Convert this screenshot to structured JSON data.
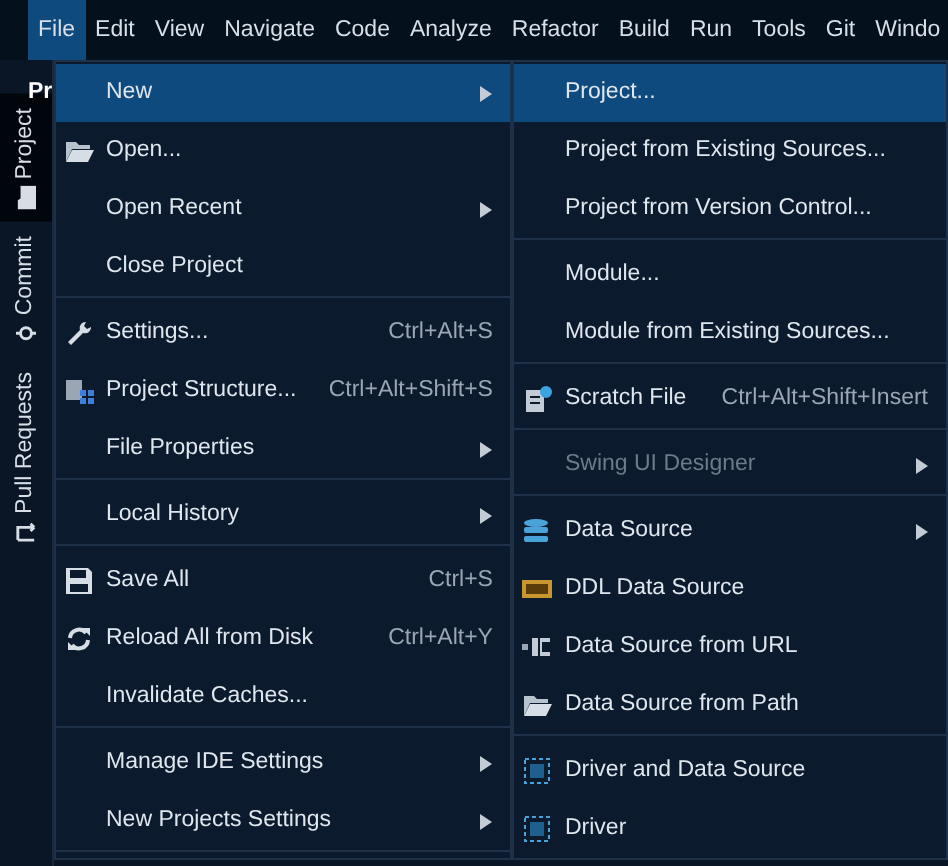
{
  "menubar": {
    "items": [
      {
        "label": "File",
        "selected": true
      },
      {
        "label": "Edit",
        "selected": false
      },
      {
        "label": "View",
        "selected": false
      },
      {
        "label": "Navigate",
        "selected": false
      },
      {
        "label": "Code",
        "selected": false
      },
      {
        "label": "Analyze",
        "selected": false
      },
      {
        "label": "Refactor",
        "selected": false
      },
      {
        "label": "Build",
        "selected": false
      },
      {
        "label": "Run",
        "selected": false
      },
      {
        "label": "Tools",
        "selected": false
      },
      {
        "label": "Git",
        "selected": false
      },
      {
        "label": "Windo",
        "selected": false
      }
    ]
  },
  "sidebar": {
    "panel_title": "Pr",
    "tabs": [
      {
        "label": "Project",
        "selected": true
      },
      {
        "label": "Commit",
        "selected": false
      },
      {
        "label": "Pull Requests",
        "selected": false
      }
    ]
  },
  "file_menu": [
    {
      "kind": "item",
      "label": "New",
      "submenu": true,
      "selected": true
    },
    {
      "kind": "item",
      "label": "Open...",
      "submenu": false,
      "selected": false
    },
    {
      "kind": "item",
      "label": "Open Recent",
      "submenu": true,
      "selected": false
    },
    {
      "kind": "item",
      "label": "Close Project",
      "submenu": false,
      "selected": false
    },
    {
      "kind": "separator"
    },
    {
      "kind": "item",
      "label": "Settings...",
      "shortcut": "Ctrl+Alt+S",
      "submenu": false,
      "selected": false
    },
    {
      "kind": "item",
      "label": "Project Structure...",
      "shortcut": "Ctrl+Alt+Shift+S",
      "submenu": false,
      "selected": false
    },
    {
      "kind": "item",
      "label": "File Properties",
      "submenu": true,
      "selected": false
    },
    {
      "kind": "separator"
    },
    {
      "kind": "item",
      "label": "Local History",
      "submenu": true,
      "selected": false
    },
    {
      "kind": "separator"
    },
    {
      "kind": "item",
      "label": "Save All",
      "shortcut": "Ctrl+S",
      "submenu": false,
      "selected": false
    },
    {
      "kind": "item",
      "label": "Reload All from Disk",
      "shortcut": "Ctrl+Alt+Y",
      "submenu": false,
      "selected": false
    },
    {
      "kind": "item",
      "label": "Invalidate Caches...",
      "submenu": false,
      "selected": false
    },
    {
      "kind": "separator"
    },
    {
      "kind": "item",
      "label": "Manage IDE Settings",
      "submenu": true,
      "selected": false
    },
    {
      "kind": "item",
      "label": "New Projects Settings",
      "submenu": true,
      "selected": false
    },
    {
      "kind": "separator"
    }
  ],
  "new_submenu": [
    {
      "kind": "item",
      "label": "Project...",
      "submenu": false,
      "disabled": false,
      "selected": true
    },
    {
      "kind": "item",
      "label": "Project from Existing Sources...",
      "submenu": false,
      "disabled": false,
      "selected": false
    },
    {
      "kind": "item",
      "label": "Project from Version Control...",
      "submenu": false,
      "disabled": false,
      "selected": false
    },
    {
      "kind": "separator"
    },
    {
      "kind": "item",
      "label": "Module...",
      "submenu": false,
      "disabled": false,
      "selected": false
    },
    {
      "kind": "item",
      "label": "Module from Existing Sources...",
      "submenu": false,
      "disabled": false,
      "selected": false
    },
    {
      "kind": "separator"
    },
    {
      "kind": "item",
      "label": "Scratch File",
      "shortcut": "Ctrl+Alt+Shift+Insert",
      "submenu": false,
      "disabled": false,
      "selected": false
    },
    {
      "kind": "separator"
    },
    {
      "kind": "item",
      "label": "Swing UI Designer",
      "submenu": true,
      "disabled": true,
      "selected": false
    },
    {
      "kind": "separator"
    },
    {
      "kind": "item",
      "label": "Data Source",
      "submenu": true,
      "disabled": false,
      "selected": false
    },
    {
      "kind": "item",
      "label": "DDL Data Source",
      "submenu": false,
      "disabled": false,
      "selected": false
    },
    {
      "kind": "item",
      "label": "Data Source from URL",
      "submenu": false,
      "disabled": false,
      "selected": false
    },
    {
      "kind": "item",
      "label": "Data Source from Path",
      "submenu": false,
      "disabled": false,
      "selected": false
    },
    {
      "kind": "separator"
    },
    {
      "kind": "item",
      "label": "Driver and Data Source",
      "submenu": false,
      "disabled": false,
      "selected": false
    },
    {
      "kind": "item",
      "label": "Driver",
      "submenu": false,
      "disabled": false,
      "selected": false
    }
  ]
}
